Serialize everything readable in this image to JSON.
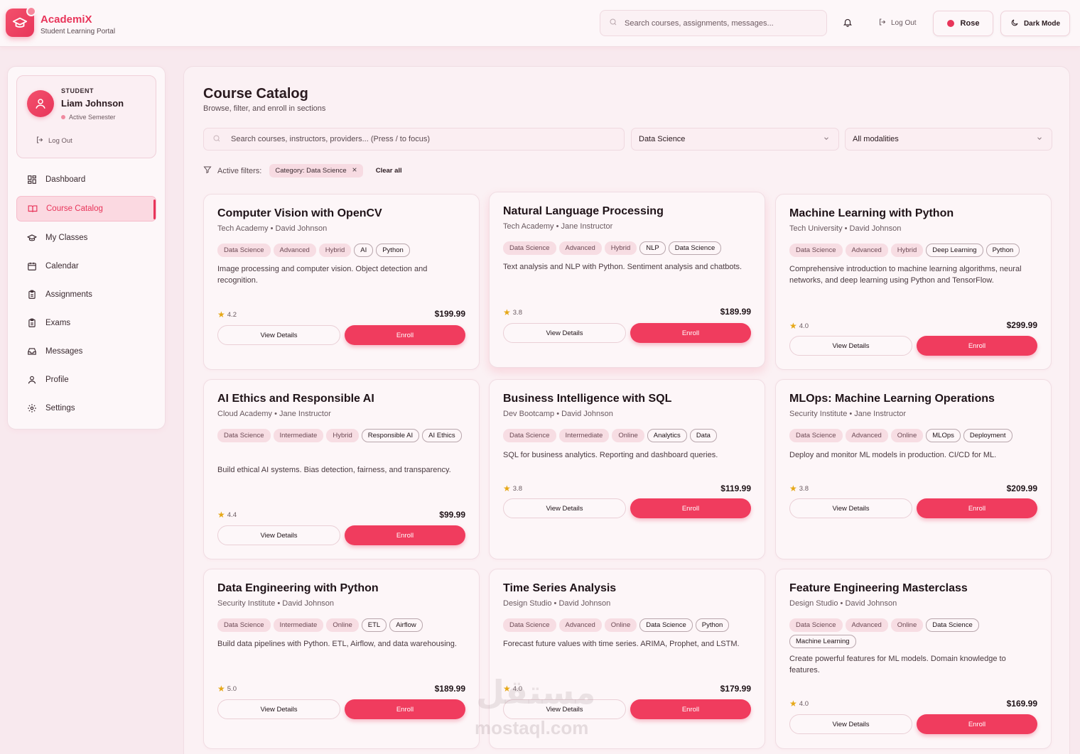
{
  "brand": {
    "name": "AcademiX",
    "subtitle": "Student Learning Portal"
  },
  "topbar": {
    "search_placeholder": "Search courses, assignments, messages...",
    "logout_label": "Log Out",
    "theme_label": "Rose",
    "dark_mode_label": "Dark Mode"
  },
  "sidebar": {
    "profile": {
      "role": "STUDENT",
      "name": "Liam Johnson",
      "status": "Active Semester",
      "logout_label": "Log Out"
    },
    "items": [
      {
        "label": "Dashboard",
        "icon": "grid-icon"
      },
      {
        "label": "Course Catalog",
        "icon": "book-icon",
        "active": true
      },
      {
        "label": "My Classes",
        "icon": "graduation-cap-icon"
      },
      {
        "label": "Calendar",
        "icon": "calendar-icon"
      },
      {
        "label": "Assignments",
        "icon": "clipboard-icon"
      },
      {
        "label": "Exams",
        "icon": "clipboard-icon"
      },
      {
        "label": "Messages",
        "icon": "inbox-icon"
      },
      {
        "label": "Profile",
        "icon": "user-icon"
      },
      {
        "label": "Settings",
        "icon": "gear-icon"
      }
    ]
  },
  "main": {
    "title": "Course Catalog",
    "subtitle": "Browse, filter, and enroll in sections",
    "search_placeholder": "Search courses, instructors, providers... (Press / to focus)",
    "category_select": "Data Science",
    "modality_select": "All modalities",
    "filters_label": "Active filters:",
    "active_filter": "Category: Data Science",
    "clear_all": "Clear all",
    "view_label": "View Details",
    "enroll_label": "Enroll"
  },
  "courses": [
    {
      "title": "Computer Vision with OpenCV",
      "meta": "Tech Academy • David Johnson",
      "soft_tags": [
        "Data Science",
        "Advanced",
        "Hybrid"
      ],
      "tags": [
        "AI",
        "Python"
      ],
      "description": "Image processing and computer vision. Object detection and recognition.",
      "rating": "4.2",
      "price": "$199.99"
    },
    {
      "title": "Natural Language Processing",
      "meta": "Tech Academy • Jane Instructor",
      "soft_tags": [
        "Data Science",
        "Advanced",
        "Hybrid"
      ],
      "tags": [
        "NLP",
        "Data Science"
      ],
      "description": "Text analysis and NLP with Python. Sentiment analysis and chatbots.",
      "rating": "3.8",
      "price": "$189.99"
    },
    {
      "title": "Machine Learning with Python",
      "meta": "Tech University • David Johnson",
      "soft_tags": [
        "Data Science",
        "Advanced",
        "Hybrid"
      ],
      "tags": [
        "Deep Learning",
        "Python"
      ],
      "description": "Comprehensive introduction to machine learning algorithms, neural networks, and deep learning using Python and TensorFlow.",
      "rating": "4.0",
      "price": "$299.99"
    },
    {
      "title": "AI Ethics and Responsible AI",
      "meta": "Cloud Academy • Jane Instructor",
      "soft_tags": [
        "Data Science",
        "Intermediate",
        "Hybrid"
      ],
      "tags": [
        "Responsible AI",
        "AI Ethics"
      ],
      "description": "Build ethical AI systems. Bias detection, fairness, and transparency.",
      "rating": "4.4",
      "price": "$99.99"
    },
    {
      "title": "Business Intelligence with SQL",
      "meta": "Dev Bootcamp • David Johnson",
      "soft_tags": [
        "Data Science",
        "Intermediate",
        "Online"
      ],
      "tags": [
        "Analytics",
        "Data"
      ],
      "description": "SQL for business analytics. Reporting and dashboard queries.",
      "rating": "3.8",
      "price": "$119.99"
    },
    {
      "title": "MLOps: Machine Learning Operations",
      "meta": "Security Institute • Jane Instructor",
      "soft_tags": [
        "Data Science",
        "Advanced",
        "Online"
      ],
      "tags": [
        "MLOps",
        "Deployment"
      ],
      "description": "Deploy and monitor ML models in production. CI/CD for ML.",
      "rating": "3.8",
      "price": "$209.99"
    },
    {
      "title": "Data Engineering with Python",
      "meta": "Security Institute • David Johnson",
      "soft_tags": [
        "Data Science",
        "Intermediate",
        "Online"
      ],
      "tags": [
        "ETL",
        "Airflow"
      ],
      "description": "Build data pipelines with Python. ETL, Airflow, and data warehousing.",
      "rating": "5.0",
      "price": "$189.99"
    },
    {
      "title": "Time Series Analysis",
      "meta": "Design Studio • David Johnson",
      "soft_tags": [
        "Data Science",
        "Advanced",
        "Online"
      ],
      "tags": [
        "Data Science",
        "Python"
      ],
      "description": "Forecast future values with time series. ARIMA, Prophet, and LSTM.",
      "rating": "4.0",
      "price": "$179.99"
    },
    {
      "title": "Feature Engineering Masterclass",
      "meta": "Design Studio • David Johnson",
      "soft_tags": [
        "Data Science",
        "Advanced",
        "Online"
      ],
      "tags": [
        "Data Science",
        "Machine Learning"
      ],
      "description": "Create powerful features for ML models. Domain knowledge to features.",
      "rating": "4.0",
      "price": "$169.99"
    }
  ],
  "watermark": {
    "arabic": "مستقل",
    "latin": "mostaql.com"
  },
  "colors": {
    "accent": "#e8355a",
    "background": "#f8e9ee",
    "star": "#e6a817"
  }
}
